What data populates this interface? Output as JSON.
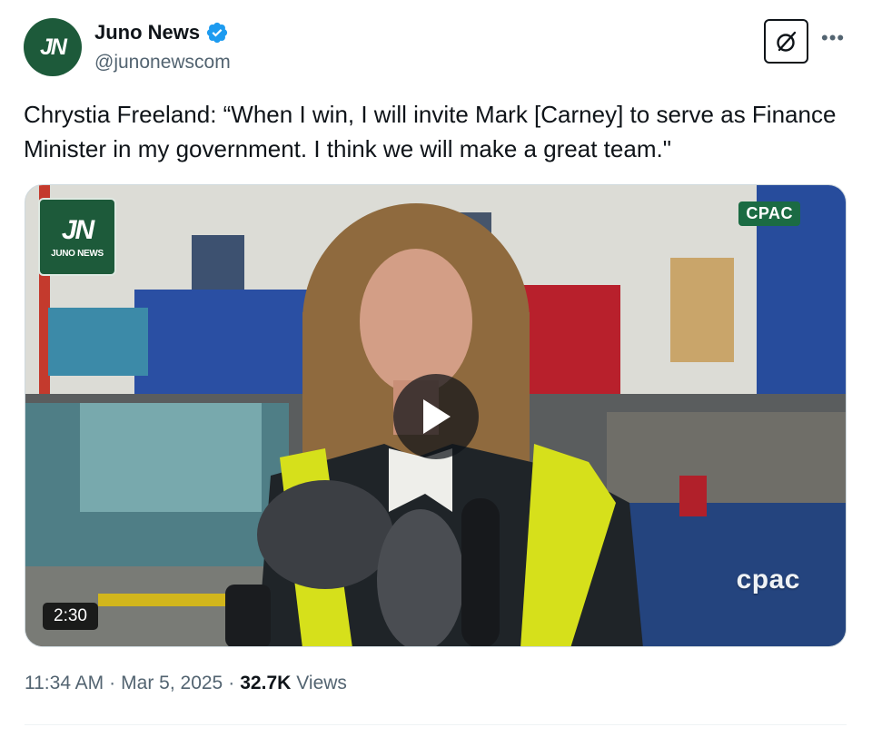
{
  "author": {
    "display_name": "Juno News",
    "handle": "@junonewscom",
    "avatar_text": "JN",
    "verified": true
  },
  "tweet": {
    "text": "Chrystia Freeland: “When I win, I will invite Mark [Carney] to serve as Finance Minister in my government. I think we will make a great team.\""
  },
  "media": {
    "logo_mark": "JN",
    "logo_subtitle": "JUNO NEWS",
    "broadcaster_tag": "CPAC",
    "broadcaster_watermark": "cpac",
    "duration": "2:30",
    "play_icon": "play-icon"
  },
  "meta": {
    "time": "11:34 AM",
    "date": "Mar 5, 2025",
    "views_count": "32.7K",
    "views_label": "Views"
  },
  "colors": {
    "brand_green": "#1d5a3a",
    "verified_blue": "#1d9bf0",
    "secondary_text": "#536471"
  }
}
